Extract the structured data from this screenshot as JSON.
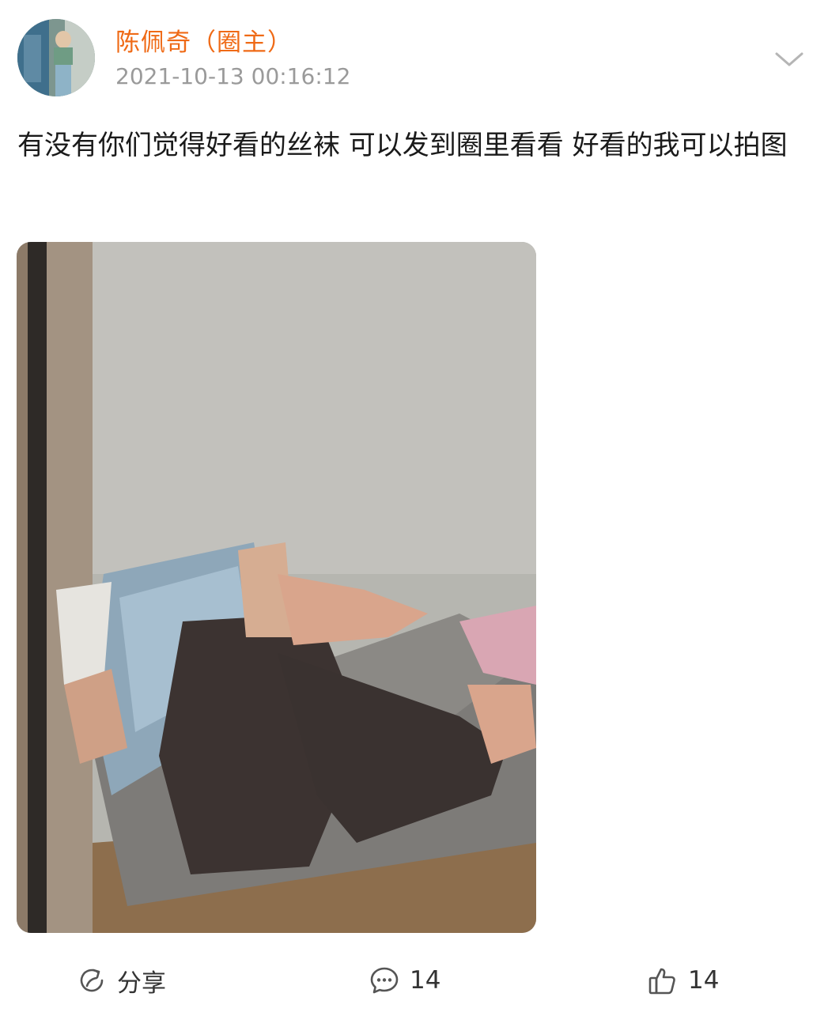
{
  "post": {
    "author": "陈佩奇（圈主）",
    "timestamp": "2021-10-13 00:16:12",
    "text": "有没有你们觉得好看的丝袜 可以发到圈里看看 好看的我可以拍图"
  },
  "actions": {
    "share_label": "分享",
    "comment_count": "14",
    "like_count": "14"
  },
  "colors": {
    "author": "#ef6a16",
    "timestamp": "#9a9a9a",
    "text": "#1a1a1a"
  },
  "icons": [
    "avatar",
    "chevron-down-icon",
    "share-icon",
    "comment-icon",
    "like-icon"
  ]
}
